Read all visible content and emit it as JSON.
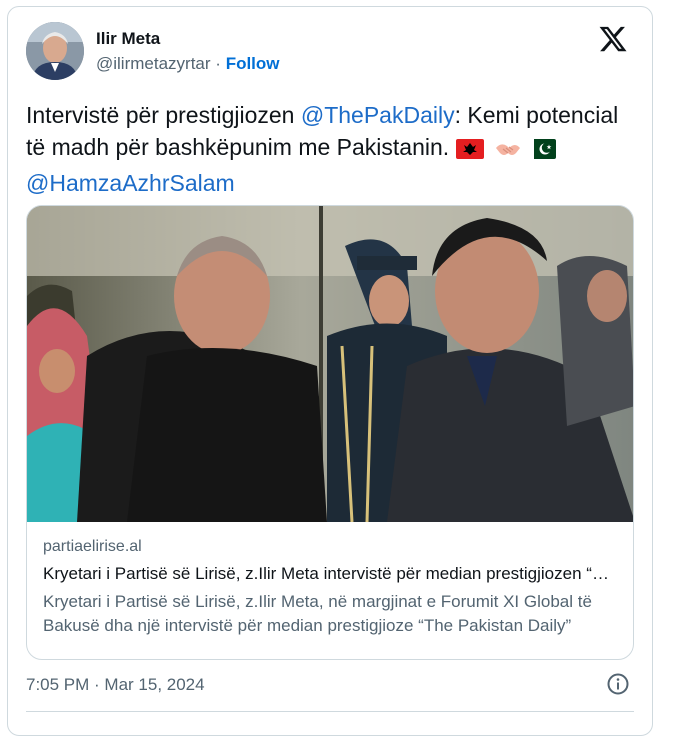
{
  "author": {
    "display_name": "Ilir Meta",
    "handle": "@ilirmetazyrtar",
    "separator": "·",
    "follow_label": "Follow"
  },
  "tweet": {
    "text_1": "Intervistë për prestigjiozen ",
    "mention_1": "@ThePakDaily",
    "text_2": ": Kemi potencial të madh për bashkëpunim me Pakistanin. ",
    "emoji_icons": [
      "albania-flag-icon",
      "handshake-icon",
      "pakistan-flag-icon"
    ],
    "mention_2": "@HamzaAzhrSalam"
  },
  "link_card": {
    "domain": "partiaelirise.al",
    "title": "Kryetari i Partisë së Lirisë, z.Ilir Meta intervistë për median prestigjiozen “The Pakistan Daily”",
    "description": "Kryetari i Partisë së Lirisë, z.Ilir Meta, në margjinat e Forumit XI Global të Bakusë dha një intervistë për median prestigjioze “The Pakistan Daily”"
  },
  "footer": {
    "timestamp": "7:05 PM · Mar 15, 2024",
    "info_icon": "info-icon"
  },
  "colors": {
    "link": "#1d6cc8",
    "follow": "#006fd6",
    "muted": "#536471",
    "border": "#cfd9de",
    "text": "#0f1419"
  }
}
